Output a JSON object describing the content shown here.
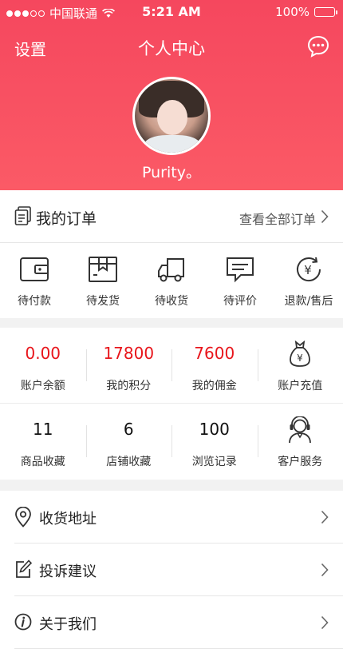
{
  "status_bar": {
    "carrier": "中国联通",
    "time": "5:21 AM",
    "battery": "100%"
  },
  "nav": {
    "left_label": "设置",
    "title": "个人中心",
    "message_icon": "chat-bubble-icon"
  },
  "profile": {
    "username": "Purity。"
  },
  "orders": {
    "title": "我的订单",
    "view_all": "查看全部订单",
    "items": [
      {
        "label": "待付款",
        "icon": "wallet-icon"
      },
      {
        "label": "待发货",
        "icon": "package-box-icon"
      },
      {
        "label": "待收货",
        "icon": "delivery-truck-icon"
      },
      {
        "label": "待评价",
        "icon": "comment-icon"
      },
      {
        "label": "退款/售后",
        "icon": "refund-yen-icon"
      }
    ]
  },
  "stats": {
    "row1": [
      {
        "value": "0.00",
        "label": "账户余额"
      },
      {
        "value": "17800",
        "label": "我的积分"
      },
      {
        "value": "7600",
        "label": "我的佣金"
      },
      {
        "label": "账户充值",
        "icon": "money-bag-icon"
      }
    ],
    "row2": [
      {
        "value": "11",
        "label": "商品收藏"
      },
      {
        "value": "6",
        "label": "店铺收藏"
      },
      {
        "value": "100",
        "label": "浏览记录"
      },
      {
        "label": "客户服务",
        "icon": "customer-service-icon"
      }
    ]
  },
  "menu": [
    {
      "label": "收货地址",
      "icon": "location-pin-icon"
    },
    {
      "label": "投诉建议",
      "icon": "edit-note-icon"
    },
    {
      "label": "关于我们",
      "icon": "info-icon"
    }
  ],
  "colors": {
    "header_top": "#f5475e",
    "header_bottom": "#fb5a66",
    "value_red": "#e8151b"
  }
}
